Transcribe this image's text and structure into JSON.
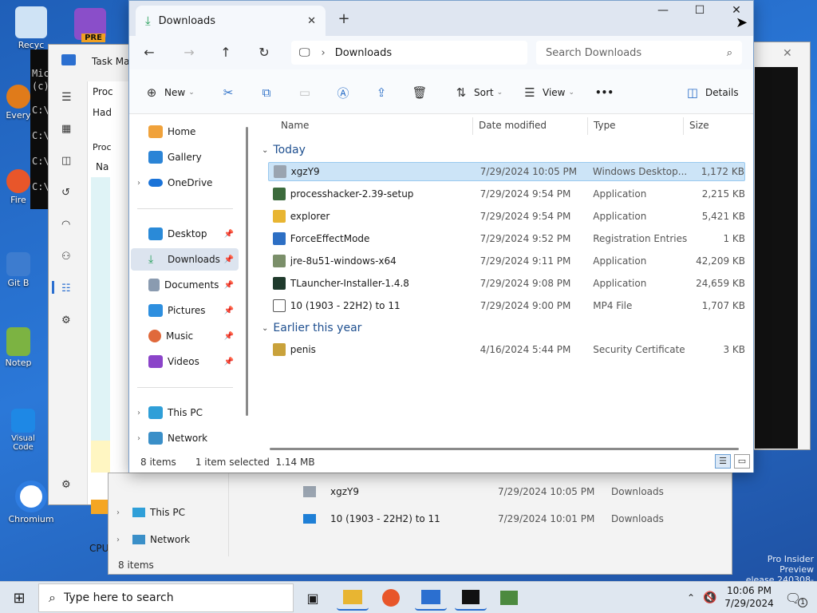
{
  "desktop": {
    "icons": [
      {
        "label": "Recyc"
      },
      {
        "label": "Every"
      },
      {
        "label": "Fire"
      },
      {
        "label": "Git B"
      },
      {
        "label": "Notep"
      },
      {
        "label": "Visual Code"
      },
      {
        "label": "Chromium"
      }
    ],
    "pre_badge": "PRE",
    "watermark_line1": "Pro Insider Preview",
    "watermark_line2": "elease.240308-1400"
  },
  "bg_console": {
    "lines": [
      "Mic",
      "(c)",
      "C:\\",
      "C:\\",
      "C:\\",
      "C:\\"
    ]
  },
  "bg_taskmgr": {
    "title": "Task Ma",
    "proc_label": "Proc",
    "col1": "Had",
    "col2": "Proc",
    "col3": "Na",
    "cpu_label": "CPU"
  },
  "bg_explorer2": {
    "nav": [
      {
        "label": "This PC"
      },
      {
        "label": "Network"
      }
    ],
    "rows": [
      {
        "name": "xgzY9",
        "date": "7/29/2024 10:05 PM",
        "location": "Downloads"
      },
      {
        "name": "10 (1903 - 22H2) to 11",
        "date": "7/29/2024 10:01 PM",
        "location": "Downloads"
      }
    ],
    "status": "8 items"
  },
  "explorer": {
    "tab_title": "Downloads",
    "new_tab": "+",
    "window_buttons": {
      "minimize": "—",
      "maximize": "☐",
      "close": "✕"
    },
    "address": {
      "breadcrumb": "Downloads",
      "search_placeholder": "Search Downloads"
    },
    "toolbar": {
      "new_label": "New",
      "sort_label": "Sort",
      "view_label": "View",
      "more_label": "•••",
      "details_label": "Details"
    },
    "nav": {
      "items": [
        {
          "label": "Home",
          "pinned": false,
          "expandable": false
        },
        {
          "label": "Gallery",
          "pinned": false,
          "expandable": false
        },
        {
          "label": "OneDrive",
          "pinned": false,
          "expandable": true
        },
        {
          "label": "Desktop",
          "pinned": true,
          "expandable": false
        },
        {
          "label": "Downloads",
          "pinned": true,
          "expandable": false,
          "selected": true
        },
        {
          "label": "Documents",
          "pinned": true,
          "expandable": false
        },
        {
          "label": "Pictures",
          "pinned": true,
          "expandable": false
        },
        {
          "label": "Music",
          "pinned": true,
          "expandable": false
        },
        {
          "label": "Videos",
          "pinned": true,
          "expandable": false
        },
        {
          "label": "This PC",
          "pinned": false,
          "expandable": true
        },
        {
          "label": "Network",
          "pinned": false,
          "expandable": true
        }
      ]
    },
    "columns": {
      "name": "Name",
      "date": "Date modified",
      "type": "Type",
      "size": "Size"
    },
    "groups": [
      {
        "label": "Today",
        "files": [
          {
            "name": "xgzY9",
            "date": "7/29/2024 10:05 PM",
            "type": "Windows Desktop...",
            "size": "1,172 KB",
            "selected": true,
            "icon_color": "#9aa4b0"
          },
          {
            "name": "processhacker-2.39-setup",
            "date": "7/29/2024 9:54 PM",
            "type": "Application",
            "size": "2,215 KB",
            "icon_color": "#3c6b3c"
          },
          {
            "name": "explorer",
            "date": "7/29/2024 9:54 PM",
            "type": "Application",
            "size": "5,421 KB",
            "icon_color": "#e8b532"
          },
          {
            "name": "ForceEffectMode",
            "date": "7/29/2024 9:52 PM",
            "type": "Registration Entries",
            "size": "1 KB",
            "icon_color": "#2d6fc4"
          },
          {
            "name": "jre-8u51-windows-x64",
            "date": "7/29/2024 9:11 PM",
            "type": "Application",
            "size": "42,209 KB",
            "icon_color": "#7b8f6a"
          },
          {
            "name": "TLauncher-Installer-1.4.8",
            "date": "7/29/2024 9:08 PM",
            "type": "Application",
            "size": "24,659 KB",
            "icon_color": "#1f3a2c"
          },
          {
            "name": "10 (1903 - 22H2) to 11",
            "date": "7/29/2024 9:00 PM",
            "type": "MP4 File",
            "size": "1,707 KB",
            "icon_color": "#5a5a5a"
          }
        ]
      },
      {
        "label": "Earlier this year",
        "files": [
          {
            "name": "penis",
            "date": "4/16/2024 5:44 PM",
            "type": "Security Certificate",
            "size": "3 KB",
            "icon_color": "#c9a23b"
          }
        ]
      }
    ],
    "status": {
      "count": "8 items",
      "selection": "1 item selected  1.14 MB"
    }
  },
  "taskbar": {
    "search_placeholder": "Type here to search",
    "time": "10:06 PM",
    "date": "7/29/2024",
    "notif_count": "1"
  },
  "colors": {
    "accent": "#2b6fd0",
    "selected_row": "#cce4f7",
    "folder": "#e8b532"
  }
}
